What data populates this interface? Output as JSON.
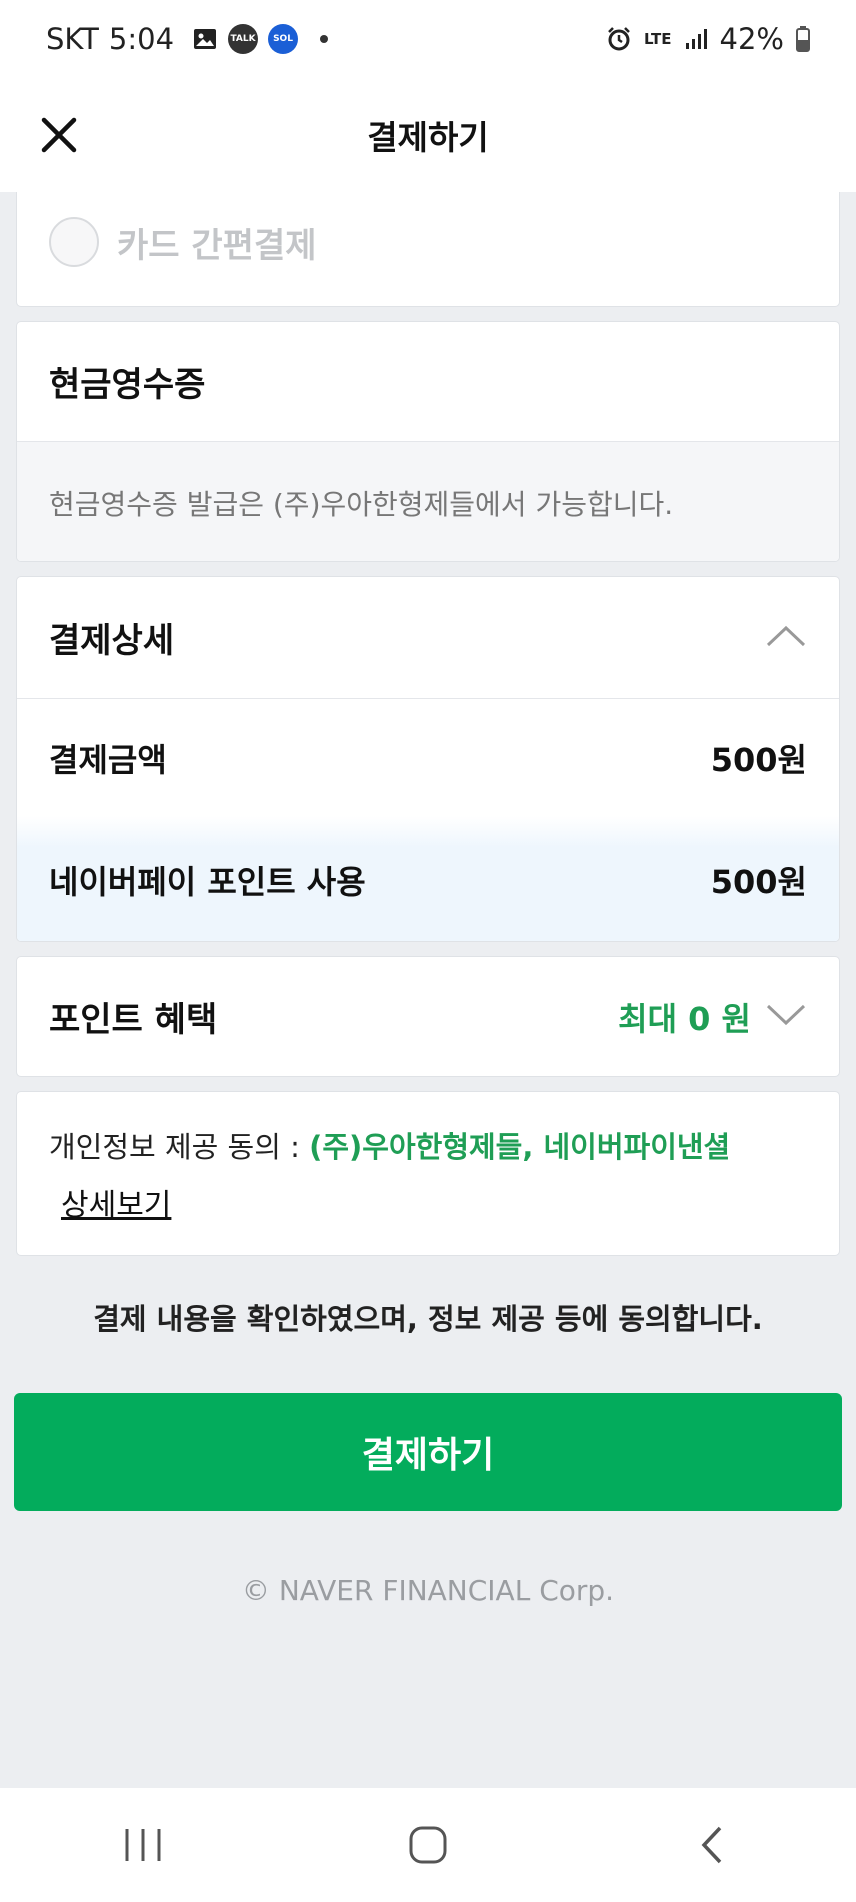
{
  "status_bar": {
    "carrier": "SKT",
    "time": "5:04",
    "talk_icon_label": "TALK",
    "sol_icon_label": "SOL",
    "network": "LTE",
    "battery": "42%"
  },
  "header": {
    "title": "결제하기"
  },
  "card_payment": {
    "option_label": "카드 간편결제"
  },
  "cash_receipt": {
    "title": "현금영수증",
    "note": "현금영수증 발급은 (주)우아한형제들에서 가능합니다."
  },
  "payment_details": {
    "title": "결제상세",
    "rows": [
      {
        "label": "결제금액",
        "value": "500원"
      },
      {
        "label": "네이버페이 포인트 사용",
        "value": "500원"
      }
    ]
  },
  "point_benefit": {
    "title": "포인트 혜택",
    "value": "최대 0 원"
  },
  "privacy": {
    "prefix": "개인정보 제공 동의 :",
    "companies": "(주)우아한형제들, 네이버파이낸셜",
    "detail_link": "상세보기"
  },
  "confirm_text": "결제 내용을 확인하였으며, 정보 제공 등에 동의합니다.",
  "pay_button": "결제하기",
  "footer": {
    "copyright": "© NAVER FINANCIAL Corp."
  },
  "colors": {
    "accent_green": "#03ac5c",
    "benefit_green": "#1f9e55",
    "background": "#eceef1"
  }
}
